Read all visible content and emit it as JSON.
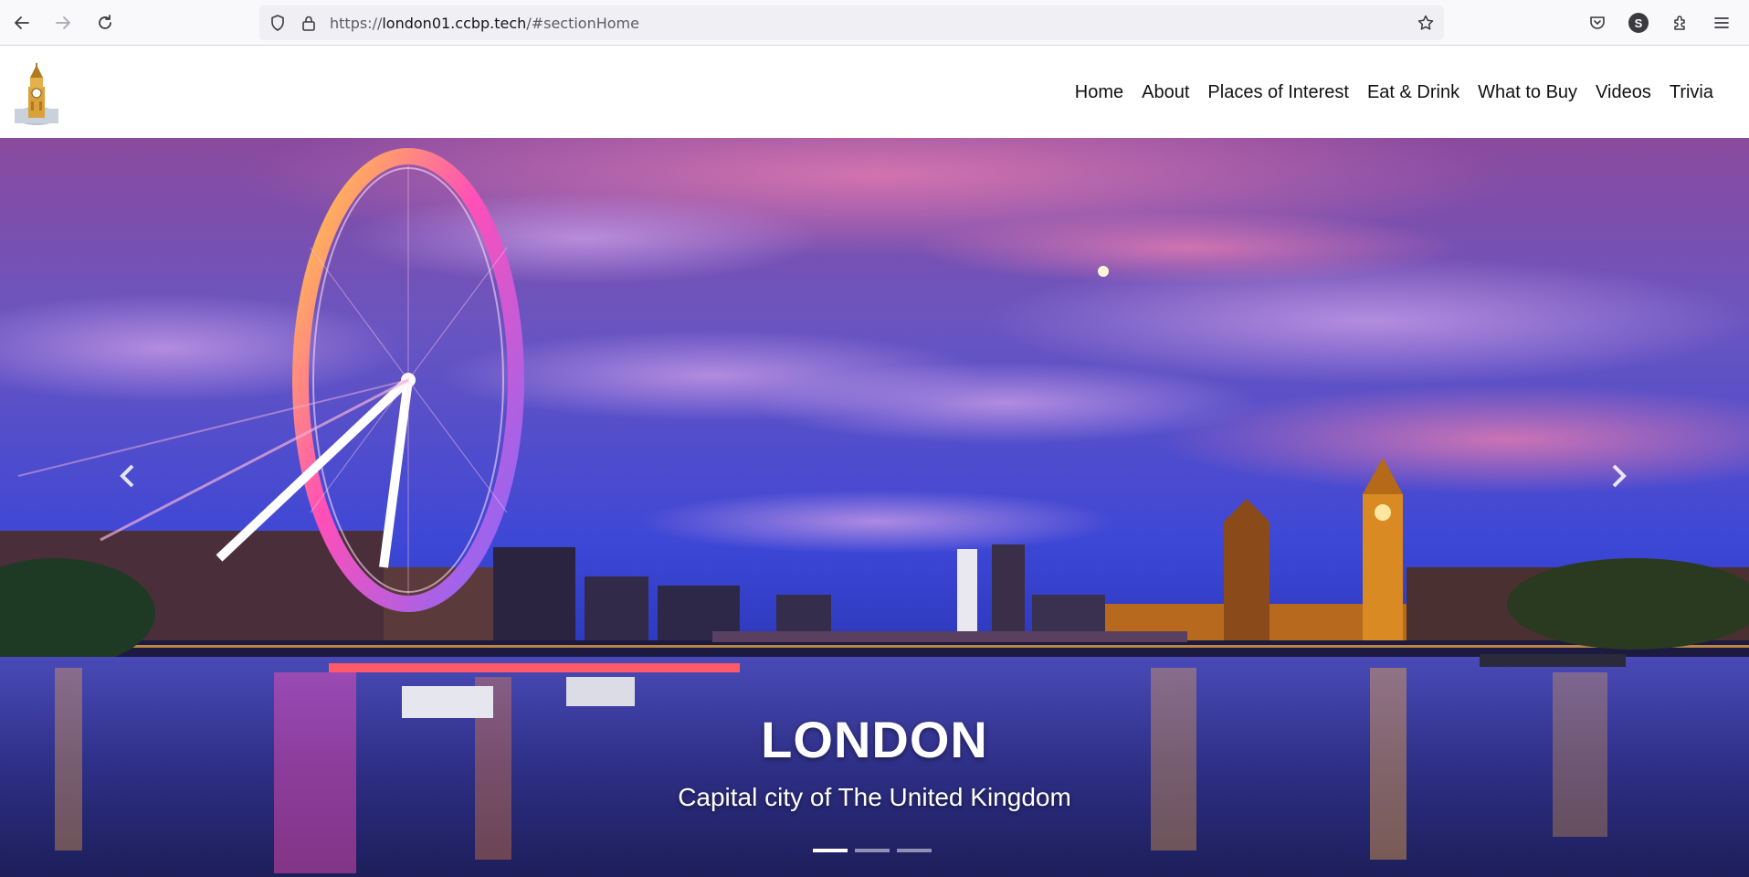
{
  "browser": {
    "url_scheme": "https://",
    "url_host": "london01.ccbp.tech",
    "url_path": "/#sectionHome",
    "profile_initial": "S",
    "icons": [
      "back-icon",
      "forward-icon",
      "reload-icon",
      "shield-icon",
      "lock-icon",
      "bookmark-star-icon",
      "pocket-icon",
      "profile-icon",
      "extensions-icon",
      "menu-icon"
    ]
  },
  "navbar": {
    "logo": "big-ben-logo",
    "links": [
      "Home",
      "About",
      "Places of Interest",
      "Eat & Drink",
      "What to Buy",
      "Videos",
      "Trivia"
    ]
  },
  "hero": {
    "title": "LONDON",
    "subtitle": "Capital city of The United Kingdom",
    "controls": [
      "chevron-left-icon",
      "chevron-right-icon"
    ],
    "slide_count": 3,
    "active_slide": 1
  },
  "colors": {
    "sky_top": "#7a4fa8",
    "sky_mid": "#4f4fd8",
    "river": "#3b3f9a",
    "lights": "#ffb347",
    "eye_pink": "#ff3fb5"
  }
}
